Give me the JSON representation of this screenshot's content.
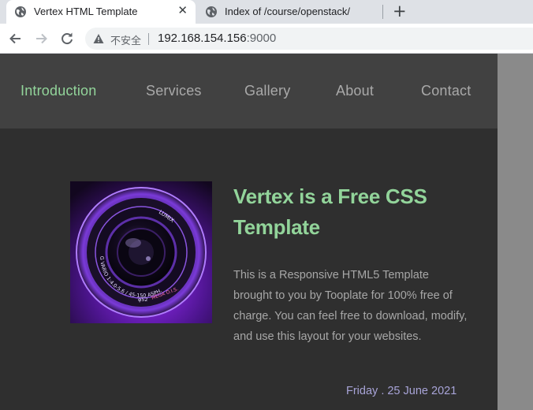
{
  "browser": {
    "tabs": [
      {
        "title": "Vertex HTML Template",
        "active": true
      },
      {
        "title": "Index of /course/openstack/",
        "active": false
      }
    ],
    "close_glyph": "✕",
    "new_tab_glyph": "+",
    "security_label": "不安全",
    "url_host": "192.168.154.156",
    "url_port": ":9000",
    "icons": {
      "tab": "globe-icon",
      "back": "arrow-left-icon",
      "forward": "arrow-right-icon",
      "reload": "reload-icon",
      "security": "warning-icon"
    }
  },
  "site": {
    "nav": [
      {
        "label": "Introduction",
        "active": true
      },
      {
        "label": "Services",
        "active": false
      },
      {
        "label": "Gallery",
        "active": false
      },
      {
        "label": "About",
        "active": false
      },
      {
        "label": "Contact",
        "active": false
      }
    ],
    "headline": "Vertex is a Free CSS Template",
    "body": "This is a Responsive HTML5 Template brought to you by Tooplate for 100% free of charge. You can feel free to download, modify, and use this layout for your websites.",
    "date": "Friday . 25 June 2021",
    "lens": {
      "brand": "LUMIX",
      "inscription": "G VARIO 1:4.0-5.6 / 45-150 ASPH.",
      "filter": "φ52",
      "mega": "MEGA O.I.S."
    }
  },
  "colors": {
    "accent_green": "#92d49a",
    "date_lavender": "#a8a4d8",
    "page_bg": "#2f2f2f",
    "nav_bg": "#414141"
  }
}
